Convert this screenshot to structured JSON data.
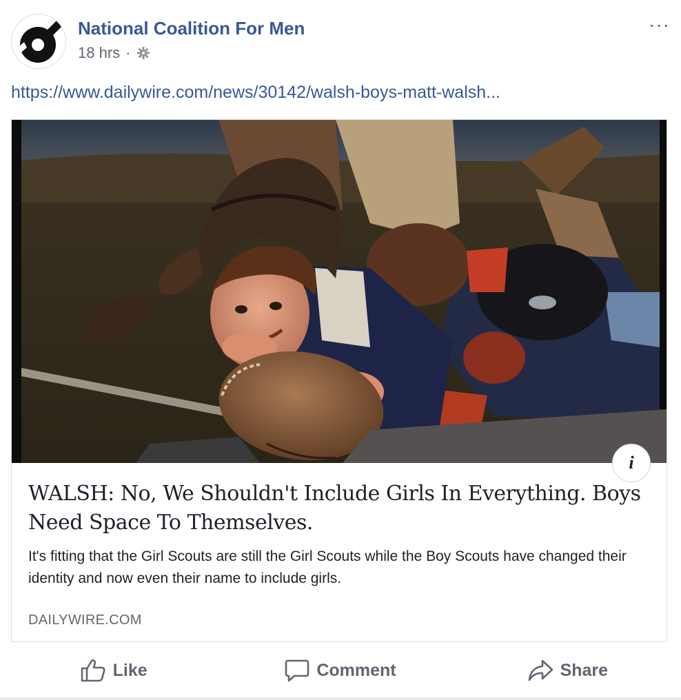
{
  "post": {
    "author": "National Coalition For Men",
    "time": "18 hrs",
    "separator": "·",
    "audience_icon": "gear-icon",
    "more_icon": "ellipsis-icon",
    "more_label": "···",
    "link_text": "https://www.dailywire.com/news/30142/walsh-boys-matt-walsh..."
  },
  "card": {
    "image_icon": "photo-boys-football",
    "info_label": "i",
    "title": "WALSH: No, We Shouldn't Include Girls In Everything. Boys Need Space To Themselves.",
    "description": "It's fitting that the Girl Scouts are still the Girl Scouts while the Boy Scouts have changed their identity and now even their name to include girls.",
    "domain": "DAILYWIRE.COM"
  },
  "actions": {
    "like": "Like",
    "comment": "Comment",
    "share": "Share"
  },
  "colors": {
    "link": "#385898",
    "text": "#1d2129",
    "muted": "#606770",
    "border": "#dadde1"
  }
}
